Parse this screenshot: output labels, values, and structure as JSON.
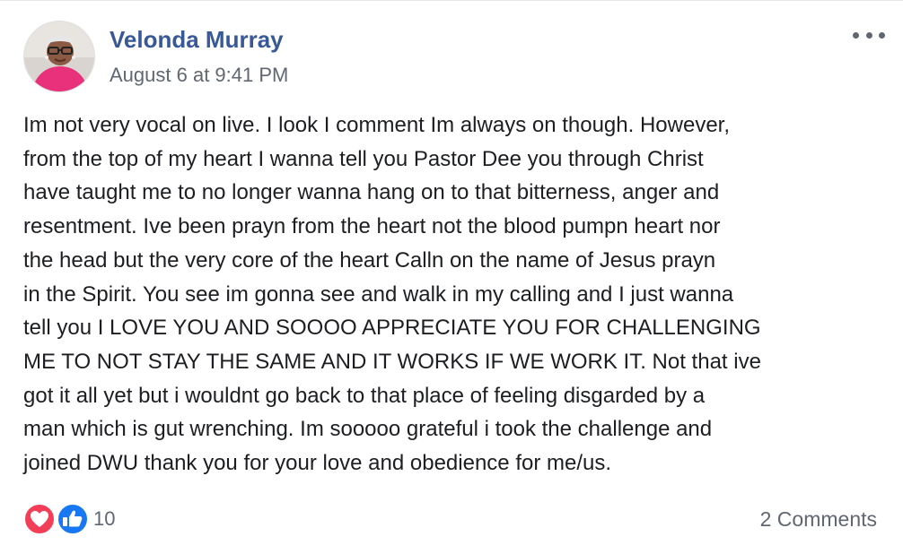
{
  "post": {
    "author": "Velonda Murray",
    "timestamp": "August 6 at 9:41 PM",
    "body": "Im not very vocal on live. I look I comment Im always on though. However,\nfrom the top of my heart I wanna tell you Pastor Dee you through Christ\nhave taught me to no longer wanna hang on to that bitterness, anger and\nresentment. Ive been prayn from the heart not the blood pumpn heart nor\nthe head but the very core of the heart Calln on the name of Jesus prayn\nin the Spirit. You see im gonna see and walk in my calling and I just wanna\ntell you I LOVE YOU AND SOOOO APPRECIATE YOU FOR CHALLENGING\nME TO NOT STAY THE SAME AND IT WORKS IF WE WORK IT. Not that ive\ngot it all yet but i wouldnt go back to that place of feeling disgarded by a\nman which is gut wrenching. Im sooooo grateful i took the challenge and\njoined DWU thank you for your love and obedience for me/us.",
    "more_icon": "more-horizontal-icon",
    "avatar_icon": "user-avatar"
  },
  "reactions": {
    "icons": [
      "love-reaction-icon",
      "like-reaction-icon"
    ],
    "count": "10",
    "comments": "2 Comments"
  },
  "colors": {
    "author_link": "#385898",
    "meta_text": "#606770",
    "body_text": "#1c1e21",
    "love_red": "#f33e58",
    "like_blue": "#1877f2"
  }
}
